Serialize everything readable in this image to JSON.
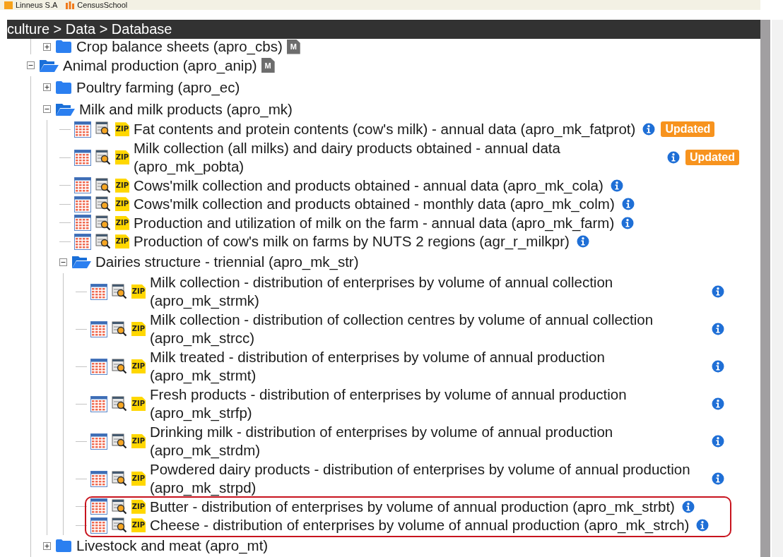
{
  "bookmarks": [
    {
      "label": "Linneus S.A",
      "kind": "feed"
    },
    {
      "label": "CensusSchool",
      "kind": "bars"
    }
  ],
  "breadcrumb": "culture > Data > Database",
  "tree": [
    {
      "kind": "folder",
      "children": [
        {
          "kind": "folder",
          "label": "Crop balance sheets (apro_cbs)",
          "expanded": false,
          "metadata_label": "M"
        }
      ]
    },
    {
      "kind": "folder",
      "label": "Animal production (apro_anip)",
      "expanded": true,
      "metadata_label": "M",
      "children": [
        {
          "kind": "folder",
          "label": "Poultry farming (apro_ec)",
          "expanded": false
        },
        {
          "kind": "folder",
          "label": "Milk and milk products (apro_mk)",
          "expanded": true,
          "children": [
            {
              "kind": "dataset",
              "label": "Fat contents and protein contents (cow's milk) - annual data (apro_mk_fatprot)",
              "zip_label": "ZIP",
              "badge": "Updated"
            },
            {
              "kind": "dataset",
              "label": "Milk collection (all milks) and dairy products obtained - annual data (apro_mk_pobta)",
              "zip_label": "ZIP",
              "badge": "Updated"
            },
            {
              "kind": "dataset",
              "label": "Cows'milk collection and products obtained - annual data (apro_mk_cola)",
              "zip_label": "ZIP"
            },
            {
              "kind": "dataset",
              "label": "Cows'milk collection and products obtained - monthly data (apro_mk_colm)",
              "zip_label": "ZIP"
            },
            {
              "kind": "dataset",
              "label": "Production and utilization of milk on the farm - annual data (apro_mk_farm)",
              "zip_label": "ZIP"
            },
            {
              "kind": "dataset",
              "label": "Production of cow's milk on farms by NUTS 2 regions (agr_r_milkpr)",
              "zip_label": "ZIP"
            },
            {
              "kind": "folder",
              "label": "Dairies structure - triennial (apro_mk_str)",
              "expanded": true,
              "children": [
                {
                  "kind": "dataset",
                  "label": "Milk collection - distribution of enterprises by volume of annual collection (apro_mk_strmk)",
                  "zip_label": "ZIP"
                },
                {
                  "kind": "dataset",
                  "label": "Milk collection - distribution of collection centres by volume of annual collection (apro_mk_strcc)",
                  "zip_label": "ZIP"
                },
                {
                  "kind": "dataset",
                  "label": "Milk treated - distribution of enterprises by volume of annual production (apro_mk_strmt)",
                  "zip_label": "ZIP"
                },
                {
                  "kind": "dataset",
                  "label": "Fresh products - distribution of enterprises by volume of annual production (apro_mk_strfp)",
                  "zip_label": "ZIP"
                },
                {
                  "kind": "dataset",
                  "label": "Drinking milk - distribution of enterprises by volume of annual production (apro_mk_strdm)",
                  "zip_label": "ZIP"
                },
                {
                  "kind": "dataset",
                  "label": "Powdered dairy products - distribution of enterprises by volume of annual production (apro_mk_strpd)",
                  "zip_label": "ZIP"
                },
                {
                  "kind": "dataset",
                  "label": "Butter - distribution of enterprises by volume of annual production (apro_mk_strbt)",
                  "zip_label": "ZIP"
                },
                {
                  "kind": "dataset",
                  "label": "Cheese - distribution of enterprises by volume of annual production (apro_mk_strch)",
                  "zip_label": "ZIP"
                }
              ]
            }
          ]
        },
        {
          "kind": "folder",
          "label": "Livestock and meat (apro_mt)",
          "expanded": false
        }
      ]
    }
  ]
}
